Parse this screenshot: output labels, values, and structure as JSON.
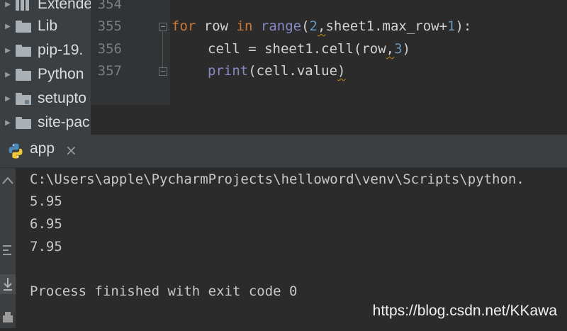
{
  "project_tree": {
    "items": [
      {
        "label": "Extende",
        "icon": "library-icon"
      },
      {
        "label": "Lib",
        "icon": "folder-icon"
      },
      {
        "label": "pip-19.",
        "icon": "folder-icon"
      },
      {
        "label": "Python",
        "icon": "folder-icon"
      },
      {
        "label": "setupto",
        "icon": "folder-icon"
      },
      {
        "label": "site-pac",
        "icon": "folder-icon"
      }
    ]
  },
  "editor": {
    "line_numbers": [
      "354",
      "355",
      "356",
      "357"
    ],
    "code": {
      "l355": {
        "kw_for": "for",
        "t1": " row ",
        "kw_in": "in",
        "t2": " ",
        "fn_range": "range",
        "t3": "(",
        "num_2": "2",
        "t4": ",",
        "t5": "sheet1.max_row+",
        "num_1": "1",
        "t6": "):"
      },
      "l356": {
        "t1": "cell = sheet1.cell(row",
        "t2": ",",
        "num_3": "3",
        "t3": ")"
      },
      "l357": {
        "fn_print": "print",
        "t1": "(cell.value",
        "t2": ")"
      }
    }
  },
  "run_panel": {
    "tab_label": "app",
    "close_symbol": "×",
    "console": {
      "lines": [
        "C:\\Users\\apple\\PycharmProjects\\helloword\\venv\\Scripts\\python.",
        "5.95",
        "6.95",
        "7.95",
        "",
        "Process finished with exit code 0"
      ]
    }
  },
  "watermark": "https://blog.csdn.net/KKawa",
  "colors": {
    "keyword": "#cc7832",
    "builtin": "#8888c6",
    "number": "#6897bb",
    "background": "#2b2b2b",
    "panel": "#3c3f41"
  }
}
